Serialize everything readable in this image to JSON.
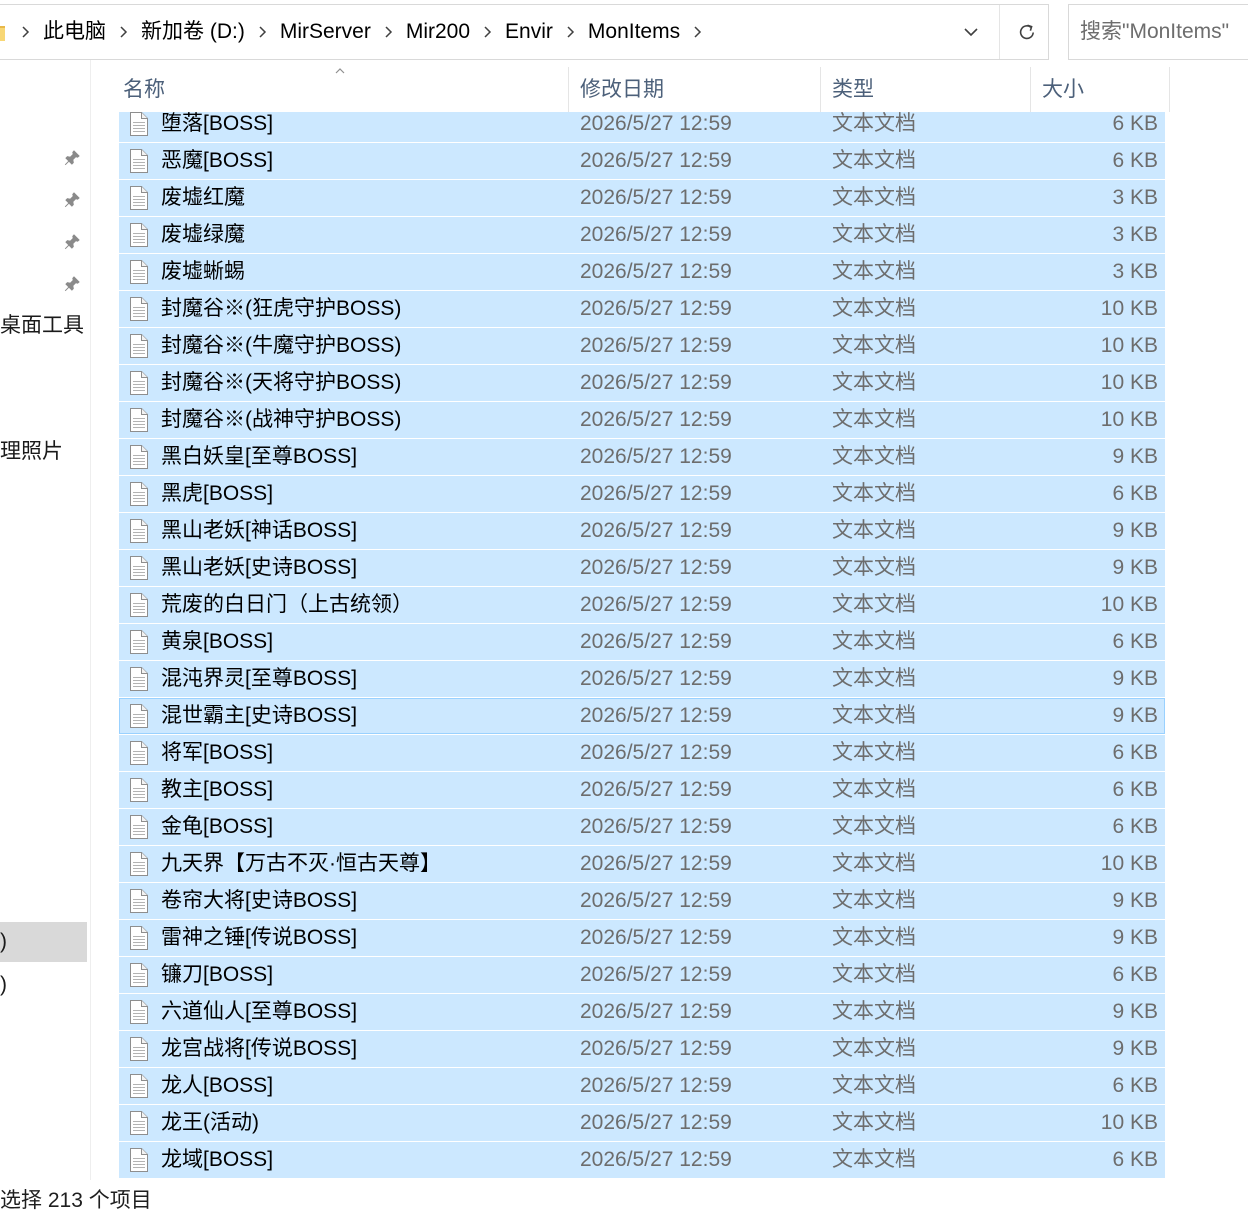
{
  "colors": {
    "selection": "#cce8ff",
    "focus_border": "#99d1ff",
    "nav_selected": "#d9d9d9",
    "header_text": "#4c607a",
    "detail_text": "#6d6d6d"
  },
  "address_bar": {
    "location_icon": "folder-icon",
    "separator_icon": "chevron-right-icon",
    "crumbs": [
      {
        "label": "此电脑"
      },
      {
        "label": "新加卷 (D:)"
      },
      {
        "label": "MirServer"
      },
      {
        "label": "Mir200"
      },
      {
        "label": "Envir"
      },
      {
        "label": "MonItems"
      }
    ],
    "history_icon": "chevron-down-icon",
    "refresh_icon": "refresh-icon"
  },
  "search": {
    "placeholder": "搜索\"MonItems\"",
    "icon": "search-icon"
  },
  "nav_pane": {
    "pinned": [
      {
        "icon": "pin-icon"
      },
      {
        "icon": "pin-icon"
      },
      {
        "icon": "pin-icon"
      },
      {
        "icon": "pin-icon"
      }
    ],
    "items": [
      {
        "label": "桌面工具",
        "selected": false
      },
      {
        "label": "理照片",
        "selected": false
      },
      {
        "label": ")",
        "selected": true
      },
      {
        "label": ")",
        "selected": false
      }
    ]
  },
  "file_list": {
    "columns": {
      "name": "名称",
      "modified": "修改日期",
      "type": "类型",
      "size": "大小"
    },
    "sort_icon": "sort-ascending-icon",
    "file_icon": "text-file-icon",
    "files": [
      {
        "name": "堕落[BOSS]",
        "modified": "2026/5/27 12:59",
        "type": "文本文档",
        "size": "6 KB",
        "selected": true
      },
      {
        "name": "恶魔[BOSS]",
        "modified": "2026/5/27 12:59",
        "type": "文本文档",
        "size": "6 KB",
        "selected": true
      },
      {
        "name": "废墟红魔",
        "modified": "2026/5/27 12:59",
        "type": "文本文档",
        "size": "3 KB",
        "selected": true
      },
      {
        "name": "废墟绿魔",
        "modified": "2026/5/27 12:59",
        "type": "文本文档",
        "size": "3 KB",
        "selected": true
      },
      {
        "name": "废墟蜥蜴",
        "modified": "2026/5/27 12:59",
        "type": "文本文档",
        "size": "3 KB",
        "selected": true
      },
      {
        "name": "封魔谷※(狂虎守护BOSS)",
        "modified": "2026/5/27 12:59",
        "type": "文本文档",
        "size": "10 KB",
        "selected": true
      },
      {
        "name": "封魔谷※(牛魔守护BOSS)",
        "modified": "2026/5/27 12:59",
        "type": "文本文档",
        "size": "10 KB",
        "selected": true
      },
      {
        "name": "封魔谷※(天将守护BOSS)",
        "modified": "2026/5/27 12:59",
        "type": "文本文档",
        "size": "10 KB",
        "selected": true
      },
      {
        "name": "封魔谷※(战神守护BOSS)",
        "modified": "2026/5/27 12:59",
        "type": "文本文档",
        "size": "10 KB",
        "selected": true
      },
      {
        "name": "黑白妖皇[至尊BOSS]",
        "modified": "2026/5/27 12:59",
        "type": "文本文档",
        "size": "9 KB",
        "selected": true
      },
      {
        "name": "黑虎[BOSS]",
        "modified": "2026/5/27 12:59",
        "type": "文本文档",
        "size": "6 KB",
        "selected": true
      },
      {
        "name": "黑山老妖[神话BOSS]",
        "modified": "2026/5/27 12:59",
        "type": "文本文档",
        "size": "9 KB",
        "selected": true
      },
      {
        "name": "黑山老妖[史诗BOSS]",
        "modified": "2026/5/27 12:59",
        "type": "文本文档",
        "size": "9 KB",
        "selected": true
      },
      {
        "name": "荒废的白日门（上古统领）",
        "modified": "2026/5/27 12:59",
        "type": "文本文档",
        "size": "10 KB",
        "selected": true
      },
      {
        "name": "黄泉[BOSS]",
        "modified": "2026/5/27 12:59",
        "type": "文本文档",
        "size": "6 KB",
        "selected": true
      },
      {
        "name": "混沌界灵[至尊BOSS]",
        "modified": "2026/5/27 12:59",
        "type": "文本文档",
        "size": "9 KB",
        "selected": true
      },
      {
        "name": "混世霸主[史诗BOSS]",
        "modified": "2026/5/27 12:59",
        "type": "文本文档",
        "size": "9 KB",
        "selected": true,
        "focused": true
      },
      {
        "name": "将军[BOSS]",
        "modified": "2026/5/27 12:59",
        "type": "文本文档",
        "size": "6 KB",
        "selected": true
      },
      {
        "name": "教主[BOSS]",
        "modified": "2026/5/27 12:59",
        "type": "文本文档",
        "size": "6 KB",
        "selected": true
      },
      {
        "name": "金龟[BOSS]",
        "modified": "2026/5/27 12:59",
        "type": "文本文档",
        "size": "6 KB",
        "selected": true
      },
      {
        "name": "九天界【万古不灭·恒古天尊】",
        "modified": "2026/5/27 12:59",
        "type": "文本文档",
        "size": "10 KB",
        "selected": true
      },
      {
        "name": "卷帘大将[史诗BOSS]",
        "modified": "2026/5/27 12:59",
        "type": "文本文档",
        "size": "9 KB",
        "selected": true
      },
      {
        "name": "雷神之锤[传说BOSS]",
        "modified": "2026/5/27 12:59",
        "type": "文本文档",
        "size": "9 KB",
        "selected": true
      },
      {
        "name": "镰刀[BOSS]",
        "modified": "2026/5/27 12:59",
        "type": "文本文档",
        "size": "6 KB",
        "selected": true
      },
      {
        "name": "六道仙人[至尊BOSS]",
        "modified": "2026/5/27 12:59",
        "type": "文本文档",
        "size": "9 KB",
        "selected": true
      },
      {
        "name": "龙宫战将[传说BOSS]",
        "modified": "2026/5/27 12:59",
        "type": "文本文档",
        "size": "9 KB",
        "selected": true
      },
      {
        "name": "龙人[BOSS]",
        "modified": "2026/5/27 12:59",
        "type": "文本文档",
        "size": "6 KB",
        "selected": true
      },
      {
        "name": "龙王(活动)",
        "modified": "2026/5/27 12:59",
        "type": "文本文档",
        "size": "10 KB",
        "selected": true
      },
      {
        "name": "龙域[BOSS]",
        "modified": "2026/5/27 12:59",
        "type": "文本文档",
        "size": "6 KB",
        "selected": true
      }
    ]
  },
  "status_bar": {
    "selection_text": "选择 213 个项目"
  }
}
